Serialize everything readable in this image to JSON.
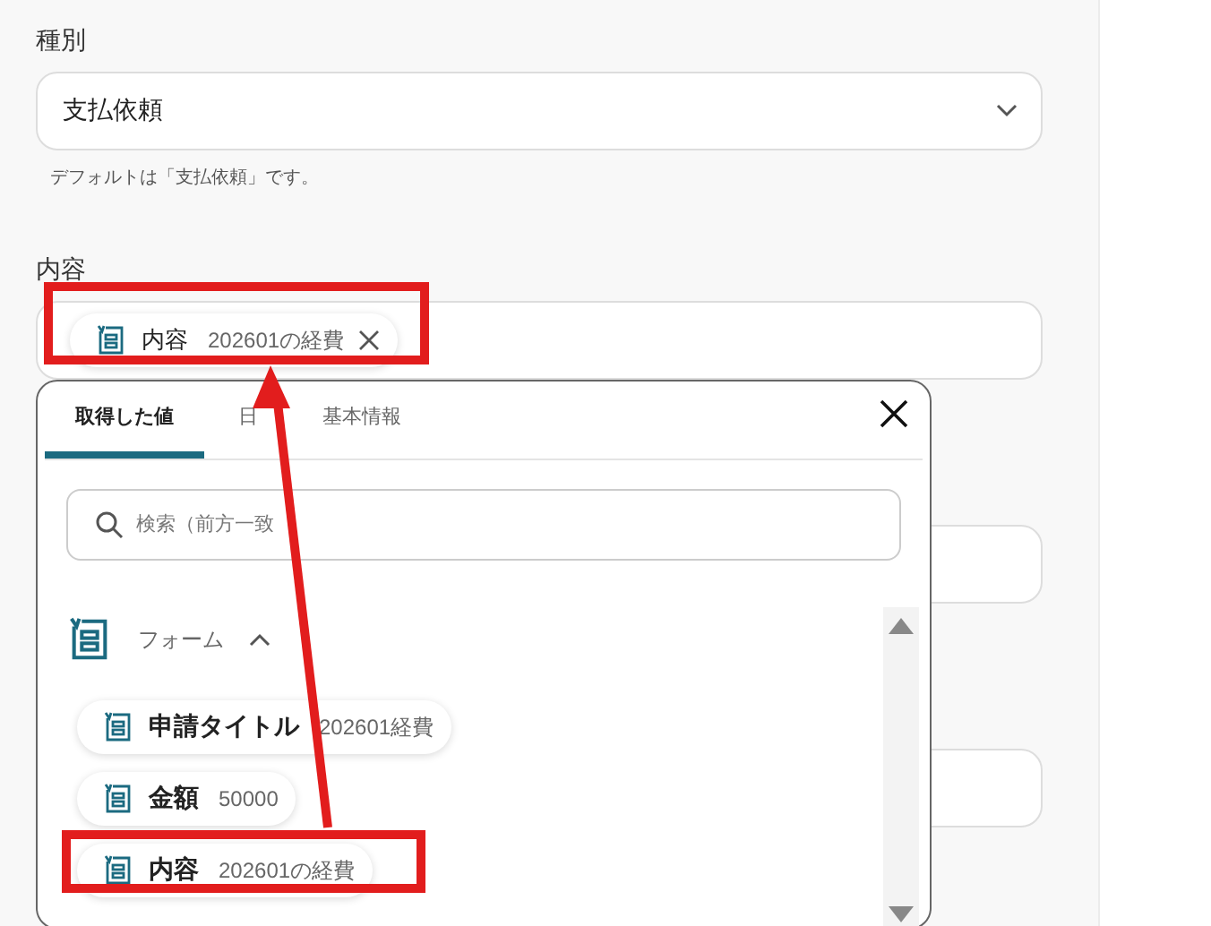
{
  "type_field": {
    "label": "種別",
    "value": "支払依頼",
    "help": "デフォルトは「支払依頼」です。"
  },
  "content_field": {
    "label": "内容",
    "chip": {
      "name": "内容",
      "value": "202601の経費"
    }
  },
  "picker": {
    "tabs": [
      {
        "label": "取得した値",
        "selected": true
      },
      {
        "label": "日",
        "selected": false
      },
      {
        "label": "基本情報",
        "selected": false
      }
    ],
    "search": {
      "placeholder": "検索（前方一致"
    },
    "group": {
      "label": "フォーム",
      "expanded": true,
      "items": [
        {
          "name": "申請タイトル",
          "value": "202601経費"
        },
        {
          "name": "金額",
          "value": "50000"
        },
        {
          "name": "内容",
          "value": "202601の経費"
        }
      ]
    }
  }
}
